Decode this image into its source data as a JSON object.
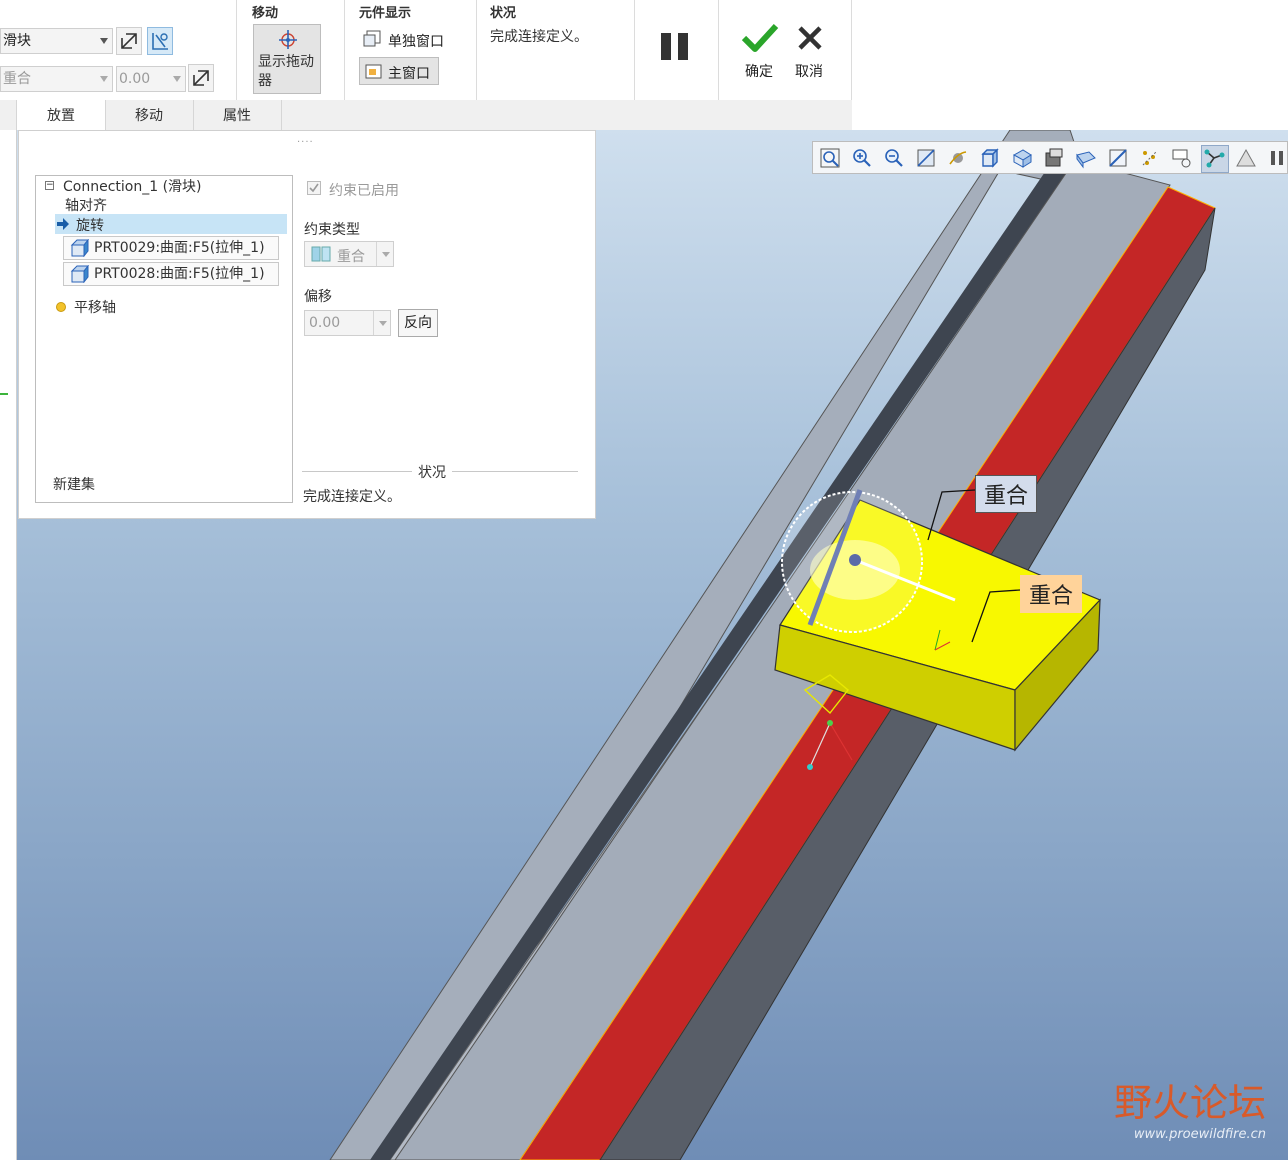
{
  "ribbon": {
    "mech_type_value": "滑块",
    "constraint_value": "重合",
    "offset_value": "0.00",
    "move_group": {
      "title": "移动",
      "button_label": "显示拖动器"
    },
    "component_display": {
      "title": "元件显示",
      "single_window": "单独窗口",
      "main_window": "主窗口"
    },
    "status_group": {
      "title": "状况",
      "text": "完成连接定义。"
    },
    "confirm_label": "确定",
    "cancel_label": "取消"
  },
  "tabs": [
    {
      "label": "放置",
      "active": true
    },
    {
      "label": "移动",
      "active": false
    },
    {
      "label": "属性",
      "active": false
    }
  ],
  "panel": {
    "tree": {
      "root": "Connection_1 (滑块)",
      "axis_align": "轴对齐",
      "rotate": "旋转",
      "refs": [
        "PRT0029:曲面:F5(拉伸_1)",
        "PRT0028:曲面:F5(拉伸_1)"
      ],
      "translate_axis": "平移轴",
      "new_set": "新建集"
    },
    "enabled_label": "约束已启用",
    "constraint_type_label": "约束类型",
    "constraint_type_value": "重合",
    "offset_label": "偏移",
    "offset_value": "0.00",
    "flip_label": "反向",
    "status_title": "状况",
    "status_text": "完成连接定义。"
  },
  "viewport": {
    "tooltip_1": "重合",
    "tooltip_2": "重合"
  },
  "watermark": {
    "brand": "野火论坛",
    "url": "www.proewildfire.cn"
  },
  "colors": {
    "accent_blue": "#c7e4f6",
    "rail_red": "#c42626",
    "slider_yellow": "#f2f200",
    "confirm_green": "#2aa52a",
    "tooltip_bg_1": "#d3dcec",
    "tooltip_bg_2": "#ffd39a"
  }
}
